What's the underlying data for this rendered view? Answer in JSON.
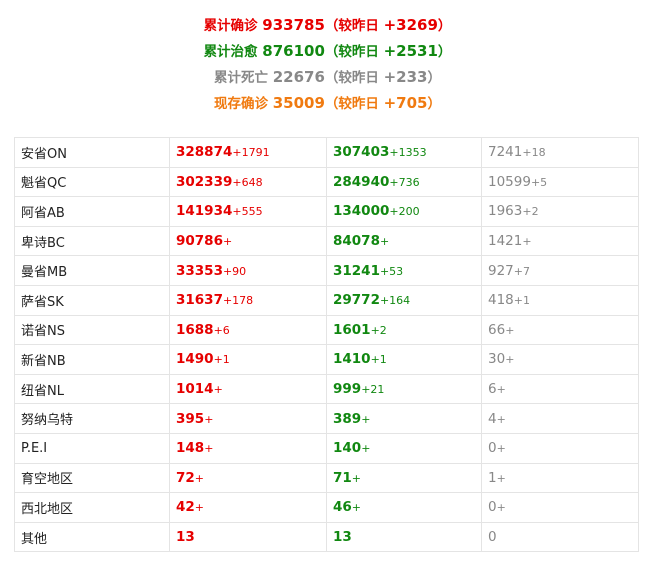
{
  "summary": {
    "confirmed": {
      "label": "累计确诊",
      "value": "933785",
      "open": "（较昨日",
      "change": "+3269",
      "close": "）"
    },
    "recovered": {
      "label": "累计治愈",
      "value": "876100",
      "open": "（较昨日",
      "change": "+2531",
      "close": "）"
    },
    "deaths": {
      "label": "累计死亡",
      "value": "22676",
      "open": "（较昨日",
      "change": "+233",
      "close": "）"
    },
    "active": {
      "label": "现存确诊",
      "value": "35009",
      "open": "（较昨日",
      "change": "+705",
      "close": "）"
    }
  },
  "colors": {
    "confirmed": "#e60000",
    "recovered": "#118811",
    "deaths": "#888888",
    "active": "#f07a10",
    "border": "#e4e4e4"
  },
  "rows": [
    {
      "name": "安省ON",
      "confirmed": "328874",
      "confirmed_delta": "+1791",
      "recovered": "307403",
      "recovered_delta": "+1353",
      "deaths": "7241",
      "deaths_delta": "+18"
    },
    {
      "name": "魁省QC",
      "confirmed": "302339",
      "confirmed_delta": "+648",
      "recovered": "284940",
      "recovered_delta": "+736",
      "deaths": "10599",
      "deaths_delta": "+5"
    },
    {
      "name": "阿省AB",
      "confirmed": "141934",
      "confirmed_delta": "+555",
      "recovered": "134000",
      "recovered_delta": "+200",
      "deaths": "1963",
      "deaths_delta": "+2"
    },
    {
      "name": "卑诗BC",
      "confirmed": "90786",
      "confirmed_delta": "+",
      "recovered": "84078",
      "recovered_delta": "+",
      "deaths": "1421",
      "deaths_delta": "+"
    },
    {
      "name": "曼省MB",
      "confirmed": "33353",
      "confirmed_delta": "+90",
      "recovered": "31241",
      "recovered_delta": "+53",
      "deaths": "927",
      "deaths_delta": "+7"
    },
    {
      "name": "萨省SK",
      "confirmed": "31637",
      "confirmed_delta": "+178",
      "recovered": "29772",
      "recovered_delta": "+164",
      "deaths": "418",
      "deaths_delta": "+1"
    },
    {
      "name": "诺省NS",
      "confirmed": "1688",
      "confirmed_delta": "+6",
      "recovered": "1601",
      "recovered_delta": "+2",
      "deaths": "66",
      "deaths_delta": "+"
    },
    {
      "name": "新省NB",
      "confirmed": "1490",
      "confirmed_delta": "+1",
      "recovered": "1410",
      "recovered_delta": "+1",
      "deaths": "30",
      "deaths_delta": "+"
    },
    {
      "name": "纽省NL",
      "confirmed": "1014",
      "confirmed_delta": "+",
      "recovered": "999",
      "recovered_delta": "+21",
      "deaths": "6",
      "deaths_delta": "+"
    },
    {
      "name": "努纳乌特",
      "confirmed": "395",
      "confirmed_delta": "+",
      "recovered": "389",
      "recovered_delta": "+",
      "deaths": "4",
      "deaths_delta": "+"
    },
    {
      "name": "P.E.I",
      "confirmed": "148",
      "confirmed_delta": "+",
      "recovered": "140",
      "recovered_delta": "+",
      "deaths": "0",
      "deaths_delta": "+"
    },
    {
      "name": "育空地区",
      "confirmed": "72",
      "confirmed_delta": "+",
      "recovered": "71",
      "recovered_delta": "+",
      "deaths": "1",
      "deaths_delta": "+"
    },
    {
      "name": "西北地区",
      "confirmed": "42",
      "confirmed_delta": "+",
      "recovered": "46",
      "recovered_delta": "+",
      "deaths": "0",
      "deaths_delta": "+"
    },
    {
      "name": "其他",
      "confirmed": "13",
      "confirmed_delta": "",
      "recovered": "13",
      "recovered_delta": "",
      "deaths": "0",
      "deaths_delta": ""
    }
  ]
}
